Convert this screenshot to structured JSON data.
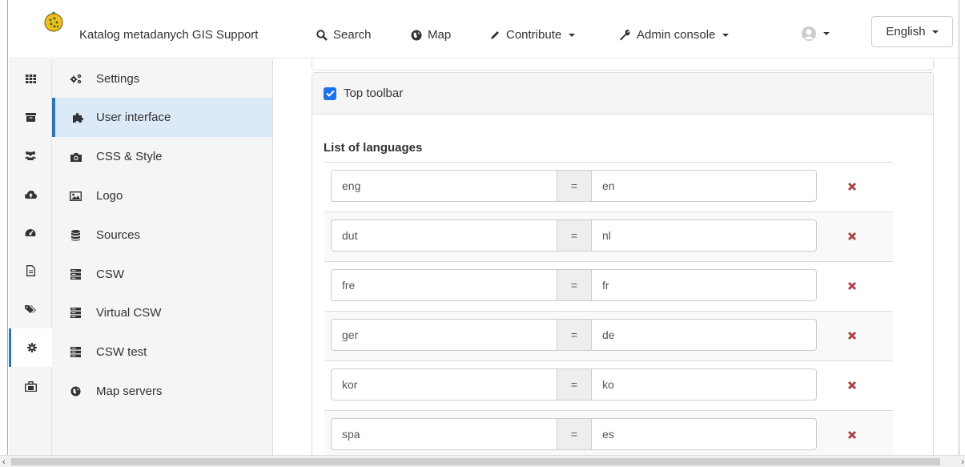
{
  "navbar": {
    "brand": "Katalog metadanych GIS Support",
    "search": "Search",
    "map": "Map",
    "contribute": "Contribute",
    "admin": "Admin console",
    "language": "English"
  },
  "rail": {
    "icons": [
      "grid-icon",
      "archive-icon",
      "users-icon",
      "cloud-upload-icon",
      "dashboard-icon",
      "file-icon",
      "tags-icon",
      "gear-icon",
      "toolbox-icon"
    ],
    "active_index": 7
  },
  "menu": {
    "items": [
      {
        "label": "Settings",
        "icon": "cogs-icon"
      },
      {
        "label": "User interface",
        "icon": "puzzle-icon"
      },
      {
        "label": "CSS & Style",
        "icon": "camera-icon"
      },
      {
        "label": "Logo",
        "icon": "image-icon"
      },
      {
        "label": "Sources",
        "icon": "database-icon"
      },
      {
        "label": "CSW",
        "icon": "server-icon"
      },
      {
        "label": "Virtual CSW",
        "icon": "server-icon"
      },
      {
        "label": "CSW test",
        "icon": "server-icon"
      },
      {
        "label": "Map servers",
        "icon": "globe-icon"
      }
    ],
    "active_index": 1
  },
  "panel": {
    "heading": "Top toolbar",
    "checked": true,
    "list_title": "List of languages",
    "separator": "=",
    "languages": [
      {
        "key": "eng",
        "value": "en"
      },
      {
        "key": "dut",
        "value": "nl"
      },
      {
        "key": "fre",
        "value": "fr"
      },
      {
        "key": "ger",
        "value": "de"
      },
      {
        "key": "kor",
        "value": "ko"
      },
      {
        "key": "spa",
        "value": "es"
      }
    ]
  },
  "colors": {
    "accent": "#2c78b8",
    "active_menu_bg": "#dce9f6",
    "remove": "#a94442",
    "checkbox": "#1a73e8"
  }
}
